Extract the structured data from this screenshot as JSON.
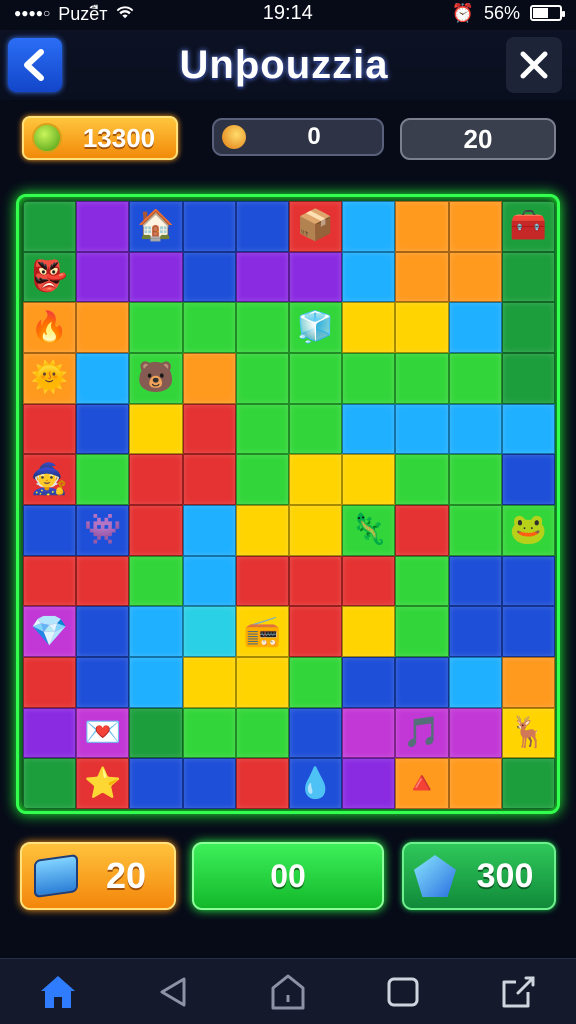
{
  "status_bar": {
    "signal": "●●●●○",
    "carrier": "Puzeืт",
    "time": "19:14",
    "battery_text": "56%",
    "battery_level": 0.56
  },
  "header": {
    "title": "Unþouzzia",
    "back_icon": "chevron-left-icon",
    "close_icon": "close-icon"
  },
  "stats": {
    "coins": "13300",
    "streak": "0",
    "moves": "20"
  },
  "board": {
    "columns": 10,
    "rows": 12,
    "colors": [
      "#e53232",
      "#ff9a1f",
      "#ffd400",
      "#33d63a",
      "#1fb0ff",
      "#1e4fd8",
      "#8a2be2",
      "#1d9e3c",
      "#2ad0e6",
      "#c238d6"
    ],
    "tile_color_index": [
      [
        7,
        6,
        5,
        5,
        5,
        0,
        4,
        1,
        1,
        7
      ],
      [
        7,
        6,
        6,
        5,
        6,
        6,
        4,
        1,
        1,
        7
      ],
      [
        1,
        1,
        3,
        3,
        3,
        3,
        2,
        2,
        4,
        7
      ],
      [
        1,
        4,
        3,
        1,
        3,
        3,
        3,
        3,
        3,
        7
      ],
      [
        0,
        5,
        2,
        0,
        3,
        3,
        4,
        4,
        4,
        4
      ],
      [
        0,
        3,
        0,
        0,
        3,
        2,
        2,
        3,
        3,
        5
      ],
      [
        5,
        5,
        0,
        4,
        2,
        2,
        3,
        0,
        3,
        3
      ],
      [
        0,
        0,
        3,
        4,
        0,
        0,
        0,
        3,
        5,
        5
      ],
      [
        9,
        5,
        4,
        8,
        2,
        0,
        2,
        3,
        5,
        5
      ],
      [
        0,
        5,
        4,
        2,
        2,
        3,
        5,
        5,
        4,
        1
      ],
      [
        6,
        9,
        7,
        3,
        3,
        5,
        9,
        9,
        9,
        2
      ],
      [
        7,
        0,
        5,
        5,
        0,
        5,
        6,
        1,
        1,
        7
      ]
    ],
    "pieces": [
      {
        "name": "house-icon",
        "glyph": "🏠"
      },
      {
        "name": "crate-icon",
        "glyph": "📦"
      },
      {
        "name": "treasure-chest-icon",
        "glyph": "🧰"
      },
      {
        "name": "goblin-icon",
        "glyph": "👺"
      },
      {
        "name": "flame-icon",
        "glyph": "🔥"
      },
      {
        "name": "sun-creature-icon",
        "glyph": "🌞"
      },
      {
        "name": "bear-creature-icon",
        "glyph": "🐻"
      },
      {
        "name": "ice-cube-icon",
        "glyph": "🧊"
      },
      {
        "name": "gnome-icon",
        "glyph": "🧙"
      },
      {
        "name": "robot-creature-icon",
        "glyph": "👾"
      },
      {
        "name": "lizard-creature-icon",
        "glyph": "🦎"
      },
      {
        "name": "frog-creature-icon",
        "glyph": "🐸"
      },
      {
        "name": "star-icon",
        "glyph": "⭐"
      },
      {
        "name": "music-note-icon",
        "glyph": "🎵"
      },
      {
        "name": "water-drop-icon",
        "glyph": "💧"
      },
      {
        "name": "deer-creature-icon",
        "glyph": "🦌"
      },
      {
        "name": "radio-icon",
        "glyph": "📻"
      },
      {
        "name": "triangle-flag-icon",
        "glyph": "🔺"
      },
      {
        "name": "crystal-icon",
        "glyph": "💎"
      },
      {
        "name": "heart-card-icon",
        "glyph": "💌"
      }
    ]
  },
  "actions": {
    "cubes": "20",
    "play": "00",
    "gems": "300"
  },
  "nav": {
    "items": [
      "home-icon",
      "back-triangle-icon",
      "home-outline-icon",
      "square-icon",
      "share-icon"
    ],
    "active_color": "#2f7cff"
  }
}
